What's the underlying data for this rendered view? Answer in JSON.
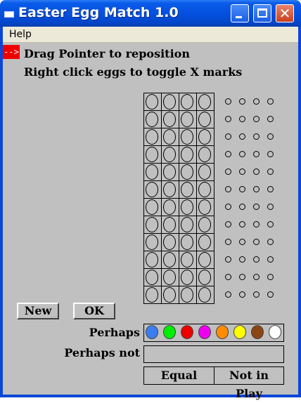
{
  "window": {
    "title": "Easter Egg Match 1.0"
  },
  "menu": {
    "help": "Help"
  },
  "pointer": {
    "glyph": "-->"
  },
  "instructions": [
    "Drag Pointer to reposition",
    "Right click eggs to toggle X marks"
  ],
  "board": {
    "rows": 12,
    "columns": 4
  },
  "buttons": {
    "new": "New",
    "ok": "OK"
  },
  "perhaps": {
    "label": "Perhaps",
    "colors": [
      {
        "name": "blue",
        "hex": "#3b7df2"
      },
      {
        "name": "green",
        "hex": "#00ee00"
      },
      {
        "name": "red",
        "hex": "#ee0000"
      },
      {
        "name": "magenta",
        "hex": "#ee00ee"
      },
      {
        "name": "orange",
        "hex": "#ff8c00"
      },
      {
        "name": "yellow",
        "hex": "#ffff00"
      },
      {
        "name": "brown",
        "hex": "#8b4513"
      },
      {
        "name": "white",
        "hex": "#ffffff"
      }
    ]
  },
  "perhaps_not": {
    "label": "Perhaps not"
  },
  "footer": {
    "equal": "Equal",
    "not_in_play": "Not in Play"
  }
}
